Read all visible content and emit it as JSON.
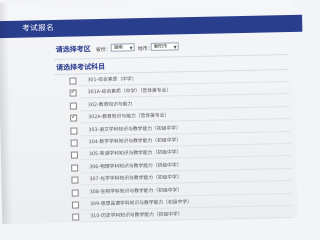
{
  "header": {
    "title": "考试报名"
  },
  "region": {
    "title": "请选择考区",
    "province_label": "省份：",
    "province_value": "湖南",
    "city_label": "地市：",
    "city_value": "衡阳市"
  },
  "subjects": {
    "title": "请选择考试科目",
    "items": [
      {
        "label": "301-综合素质（中学）",
        "checked": false
      },
      {
        "label": "301A-综合素质（中学）（音体美专业）",
        "checked": true
      },
      {
        "label": "302-教育知识与能力",
        "checked": false
      },
      {
        "label": "302A-教育知识与能力（音体美专业）",
        "checked": true
      },
      {
        "label": "303-语文学科知识与教学能力（初级中学）",
        "checked": false
      },
      {
        "label": "304-数学学科知识与教学能力（初级中学）",
        "checked": false
      },
      {
        "label": "305-英语学科知识与教学能力（初级中学）",
        "checked": false
      },
      {
        "label": "306-物理学科知识与教学能力（初级中学）",
        "checked": false
      },
      {
        "label": "307-化学学科知识与教学能力（初级中学）",
        "checked": false
      },
      {
        "label": "308-生物学科知识与教学能力（初级中学）",
        "checked": false
      },
      {
        "label": "309-思想品德学科知识与教学能力（初级中学）",
        "checked": false
      },
      {
        "label": "310-历史学科知识与教学能力（初级中学）",
        "checked": false
      }
    ]
  },
  "icons": {
    "select_arrow": "chevron-down-icon",
    "check": "checkmark-icon"
  },
  "colors": {
    "header_bg": "#2a3e8e",
    "section_title": "#2d3f8e"
  }
}
